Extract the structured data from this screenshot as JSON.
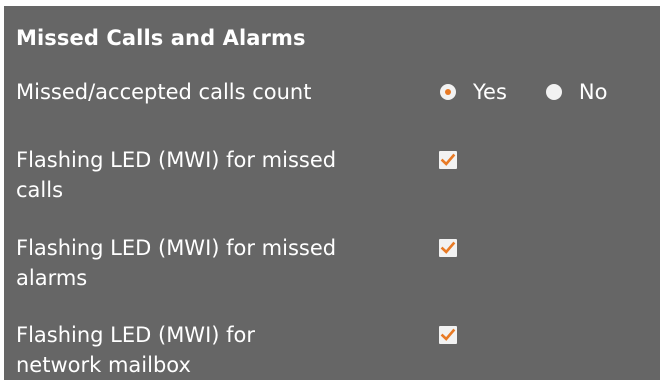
{
  "section": {
    "title": "Missed Calls and Alarms"
  },
  "calls_count": {
    "label": "Missed/accepted calls count",
    "options": [
      {
        "label": "Yes",
        "selected": true
      },
      {
        "label": "No",
        "selected": false
      }
    ]
  },
  "led_missed_calls": {
    "label_line1": "Flashing LED (MWI) for missed",
    "label_line2": "calls",
    "checked": true
  },
  "led_missed_alarms": {
    "label_line1": "Flashing LED (MWI) for missed",
    "label_line2": "alarms",
    "checked": true
  },
  "led_network_mailbox": {
    "label_line1": "Flashing LED (MWI) for",
    "label_line2": "network mailbox",
    "checked": true
  },
  "colors": {
    "panel_background": "#666666",
    "accent": "#e87a25",
    "control_background": "#f2f2f2",
    "text": "#ffffff"
  },
  "icons": {
    "checkbox_mark": "checkmark-icon",
    "radio_mark": "radio-dot-icon"
  }
}
